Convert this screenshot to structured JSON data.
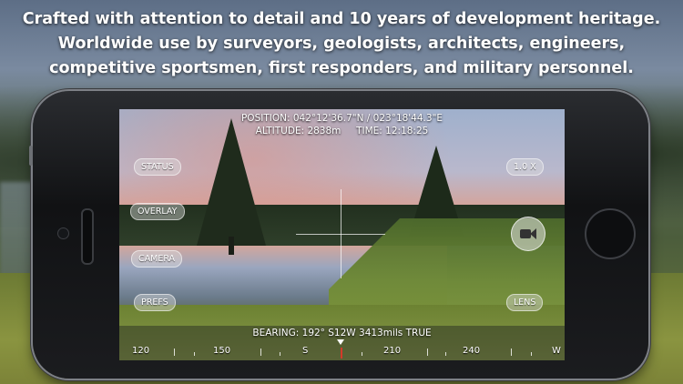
{
  "headline": {
    "line1": "Crafted with attention to detail and 10 years of development heritage.",
    "line2": "Worldwide use by surveyors, geologists, architects, engineers,",
    "line3": "competitive sportsmen, first responders, and military personnel."
  },
  "overlay": {
    "position": "POSITION: 042°12'36.7\"N / 023°18'44.3\"E",
    "altitude_time": "ALTITUDE: 2838m     TIME: 12:18:25",
    "bearing": "BEARING: 192° S12W  3413mils  TRUE"
  },
  "buttons": {
    "status": "STATUS",
    "overlay": "OVERLAY",
    "camera": "CAMERA",
    "prefs": "PREFS",
    "zoom": "1.0 X",
    "lens": "LENS"
  },
  "compass_scale": [
    "120",
    "150",
    "S",
    "210",
    "240",
    "W"
  ],
  "icons": {
    "video_camera": "video-camera-icon",
    "crosshair": "crosshair-icon",
    "bearing_pointer": "triangle-down-icon"
  },
  "colors": {
    "pill_bg": "#e1e1e1",
    "heading_marker": "#d43a2a",
    "text": "#ffffff"
  }
}
